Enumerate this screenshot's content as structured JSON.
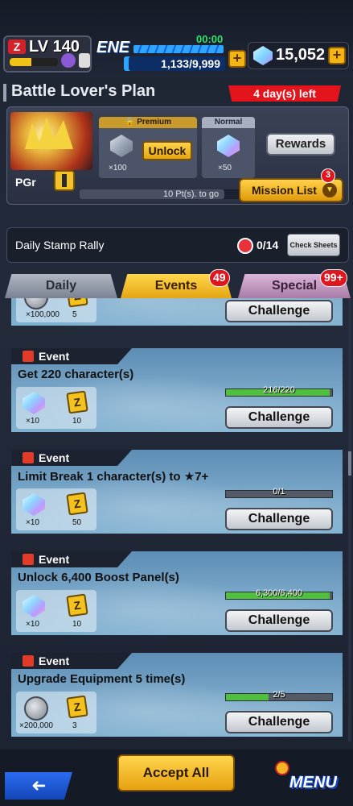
{
  "status": {
    "rank_label": "LV",
    "rank_value": "140",
    "rank_progress": 0.45,
    "energy_label": "ENE",
    "energy_timer": "00:00",
    "energy_value": "1,133/9,999",
    "chrono_crystals": "15,052",
    "plus": "+"
  },
  "plan": {
    "title": "Battle Lover's Plan",
    "time_left": "4 day(s) left",
    "grade_label": "PGr",
    "points_to_go": "10 Pt(s). to go",
    "premium_label": "Premium",
    "premium_qty": "×100",
    "unlock_label": "Unlock",
    "normal_label": "Normal",
    "normal_qty": "×50",
    "rewards_label": "Rewards",
    "mission_list_label": "Mission List",
    "mission_list_badge": "3"
  },
  "stamp": {
    "label": "Daily Stamp Rally",
    "count": "0/14",
    "check_label": "Check Sheets"
  },
  "tabs": [
    {
      "label": "Daily"
    },
    {
      "label": "Events",
      "badge": "49"
    },
    {
      "label": "Special",
      "badge": "99+"
    }
  ],
  "missions": [
    {
      "tag": "Event",
      "title": "",
      "reward1_qty": "×100,000",
      "reward2_qty": "5",
      "progress": "",
      "fill": 0,
      "button": "Challenge"
    },
    {
      "tag": "Event",
      "title": "Get 220 character(s)",
      "reward1_qty": "×10",
      "reward2_qty": "10",
      "progress": "216/220",
      "fill": 0.98,
      "button": "Challenge"
    },
    {
      "tag": "Event",
      "title": "Limit Break 1 character(s) to ★7+",
      "reward1_qty": "×10",
      "reward2_qty": "50",
      "progress": "0/1",
      "fill": 0,
      "button": "Challenge"
    },
    {
      "tag": "Event",
      "title": "Unlock 6,400 Boost Panel(s)",
      "reward1_qty": "×10",
      "reward2_qty": "10",
      "progress": "6,300/6,400",
      "fill": 0.98,
      "button": "Challenge"
    },
    {
      "tag": "Event",
      "title": "Upgrade Equipment 5 time(s)",
      "reward1_qty": "×200,000",
      "reward2_qty": "3",
      "progress": "2/5",
      "fill": 0.4,
      "button": "Challenge"
    }
  ],
  "bottom": {
    "back_label": "➜",
    "accept_all_label": "Accept All",
    "menu_label": "MENU"
  }
}
